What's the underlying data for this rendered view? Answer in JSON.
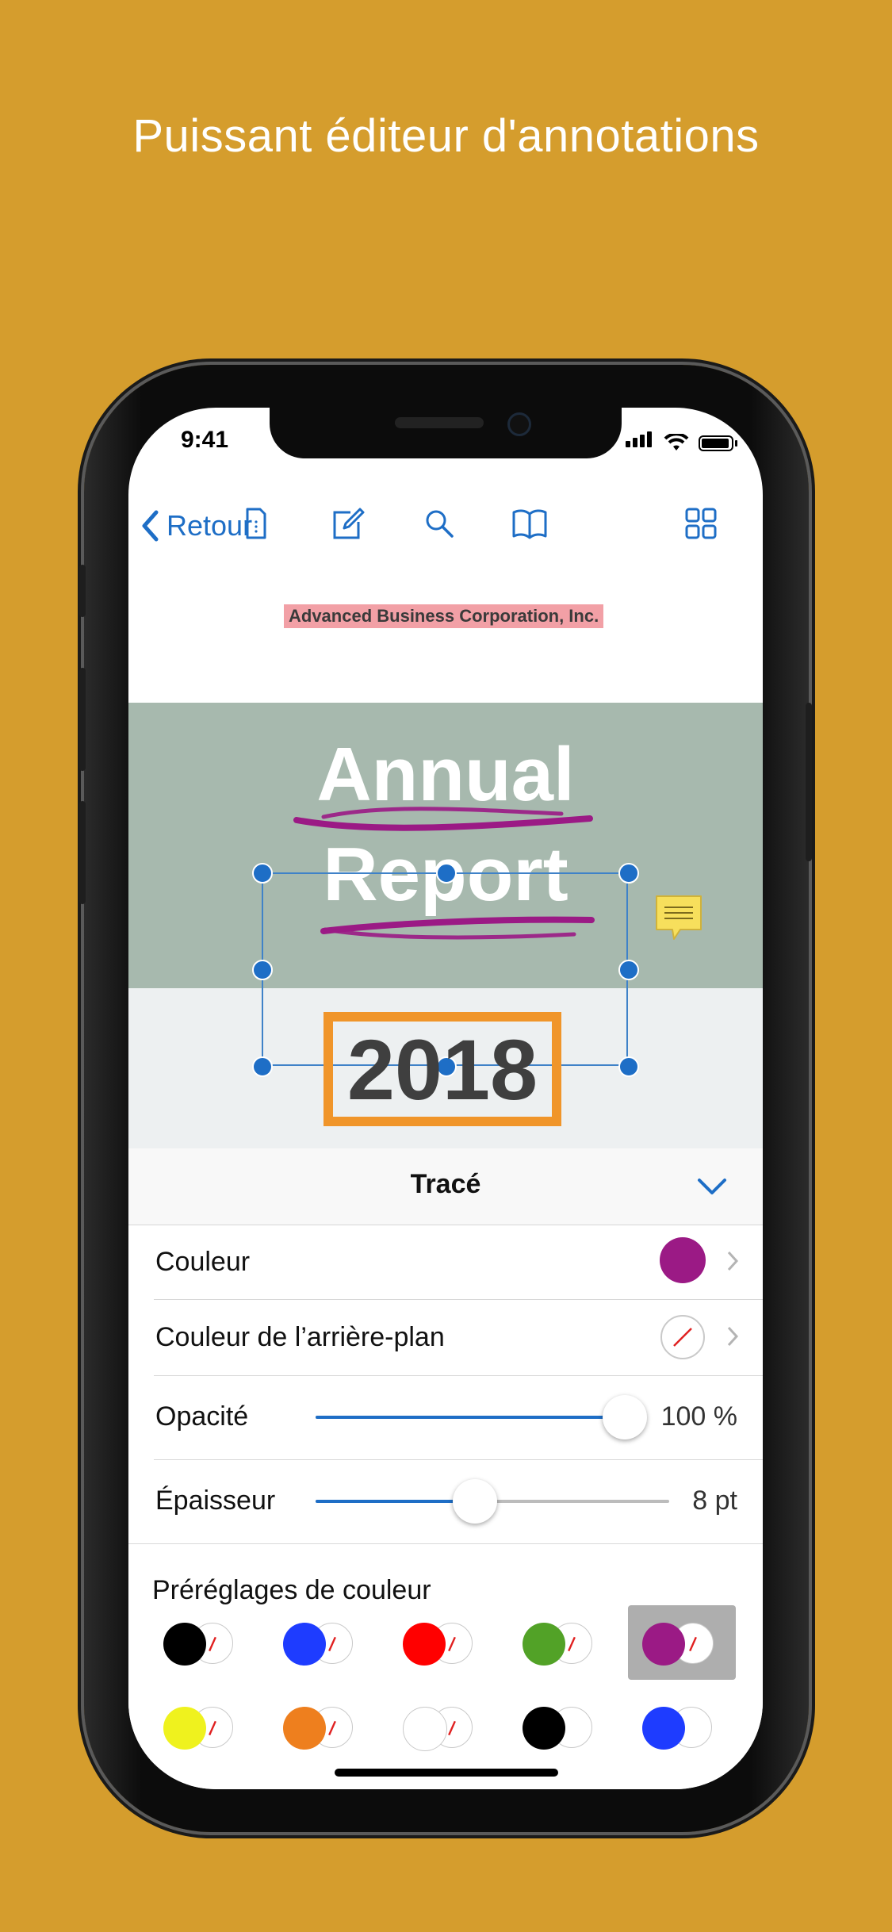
{
  "headline": "Puissant éditeur d'annotations",
  "status": {
    "time": "9:41"
  },
  "navbar": {
    "back_label": "Retour",
    "icons": [
      "document-icon",
      "edit-icon",
      "search-icon",
      "book-icon",
      "grid-icon"
    ]
  },
  "document": {
    "company": "Advanced Business Corporation, Inc.",
    "title_line1": "Annual",
    "title_line2": "Report",
    "year": "2018",
    "colors": {
      "band_green": "#A7B9AE",
      "year_border": "#F0952A",
      "ink_annotation": "#9B1A85",
      "highlight": "#F2A0A6",
      "selection": "#1E6EC6"
    }
  },
  "panel": {
    "title": "Tracé",
    "color_label": "Couleur",
    "color_value": "#9B1A85",
    "background_label": "Couleur de l’arrière-plan",
    "opacity_label": "Opacité",
    "opacity_value": "100 %",
    "opacity_level": 1.0,
    "thickness_label": "Épaisseur",
    "thickness_value": "8 pt",
    "thickness_level": 0.45,
    "presets_label": "Préréglages de couleur",
    "presets": [
      {
        "fg": "#000000",
        "bg": "none"
      },
      {
        "fg": "#1E3CFF",
        "bg": "none"
      },
      {
        "fg": "#FF0000",
        "bg": "none"
      },
      {
        "fg": "#52A227",
        "bg": "none"
      },
      {
        "fg": "#9B1A85",
        "bg": "none",
        "selected": true
      },
      {
        "fg": "#EFF21E",
        "bg": "none"
      },
      {
        "fg": "#EE7F1E",
        "bg": "none"
      },
      {
        "fg": "#FFFFFF",
        "bg": "none"
      },
      {
        "fg": "#000000",
        "bg": "#FFFFFF"
      },
      {
        "fg": "#1E3CFF",
        "bg": "#FFFFFF"
      }
    ]
  }
}
